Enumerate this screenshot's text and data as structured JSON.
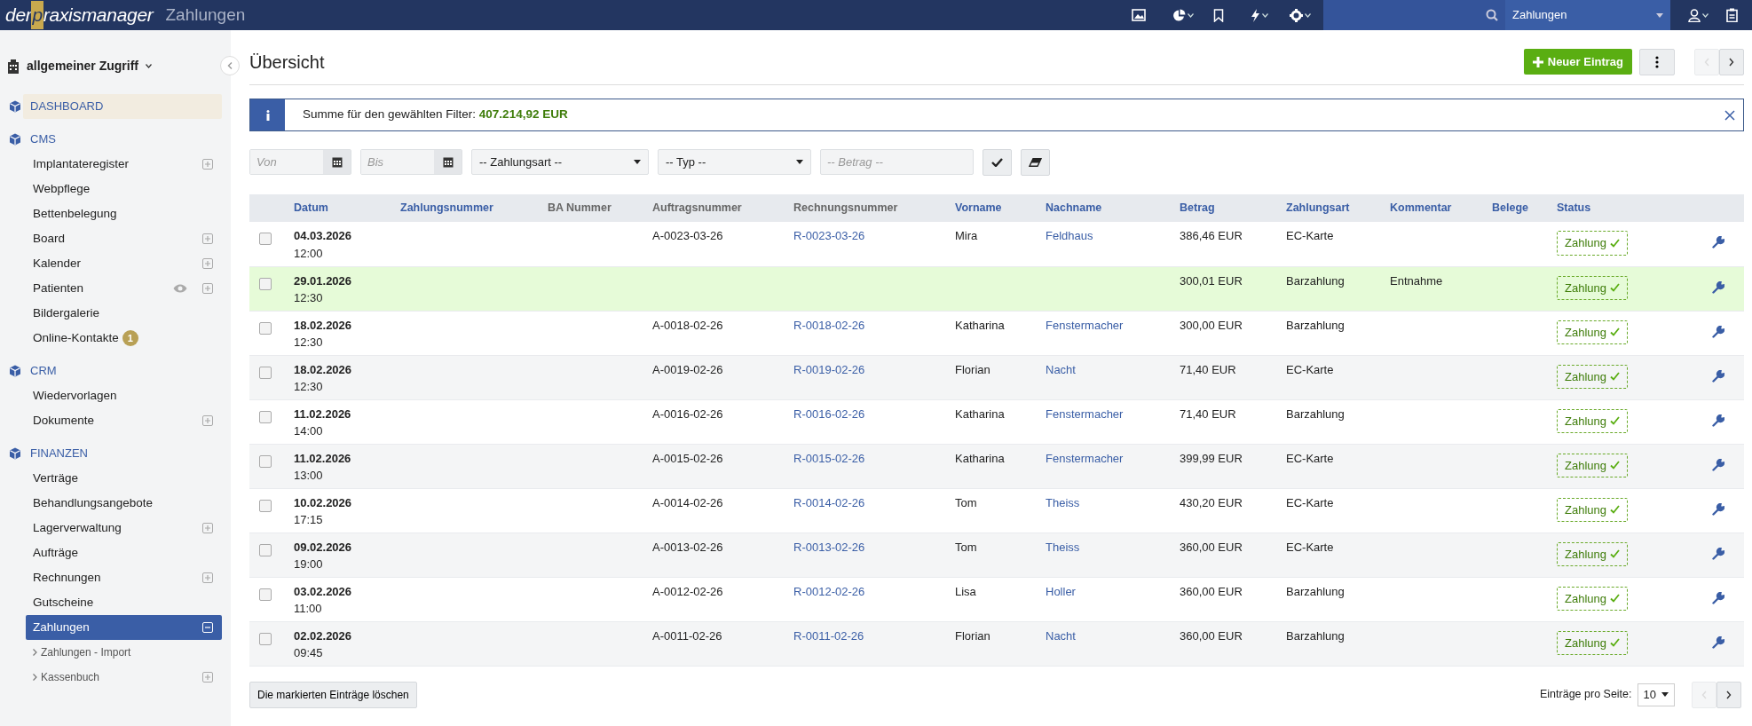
{
  "topbar": {
    "logo": {
      "prefix": "der",
      "highlight": "p",
      "suffix": "raxismanager"
    },
    "title": "Zahlungen",
    "module_select": "Zahlungen"
  },
  "sidebar": {
    "workspace": "allgemeiner Zugriff",
    "sections": [
      {
        "title": "DASHBOARD",
        "selected": true
      },
      {
        "title": "CMS",
        "selected": false,
        "items": [
          {
            "label": "Implantateregister",
            "expanded": false,
            "eye": false,
            "selected": false
          },
          {
            "label": "Webpflege",
            "eye": false,
            "selected": false
          },
          {
            "label": "Bettenbelegung",
            "eye": false,
            "selected": false
          },
          {
            "label": "Board",
            "expanded": false,
            "eye": false,
            "selected": false
          },
          {
            "label": "Kalender",
            "expanded": false,
            "eye": false,
            "selected": false
          },
          {
            "label": "Patienten",
            "expanded": false,
            "eye": true,
            "selected": false
          },
          {
            "label": "Bildergalerie",
            "eye": false,
            "selected": false
          },
          {
            "label": "Online-Kontakte",
            "eye": false,
            "selected": false,
            "badge": "1"
          }
        ]
      },
      {
        "title": "CRM",
        "selected": false,
        "items": [
          {
            "label": "Wiedervorlagen",
            "eye": false,
            "selected": false
          },
          {
            "label": "Dokumente",
            "expanded": false,
            "eye": false,
            "selected": false
          }
        ]
      },
      {
        "title": "FINANZEN",
        "selected": false,
        "items": [
          {
            "label": "Verträge",
            "eye": false,
            "selected": false
          },
          {
            "label": "Behandlungsangebote",
            "eye": false,
            "selected": false
          },
          {
            "label": "Lagerverwaltung",
            "expanded": false,
            "eye": false,
            "selected": false
          },
          {
            "label": "Aufträge",
            "eye": false,
            "selected": false
          },
          {
            "label": "Rechnungen",
            "expanded": false,
            "eye": false,
            "selected": false
          },
          {
            "label": "Gutscheine",
            "eye": false,
            "selected": false
          },
          {
            "label": "Zahlungen",
            "expanded": true,
            "eye": false,
            "selected": true,
            "children": [
              {
                "label": "Zahlungen - Import",
                "eye": false,
                "selected": false
              },
              {
                "label": "Kassenbuch",
                "expanded": false,
                "eye": false,
                "selected": false
              }
            ]
          }
        ]
      }
    ]
  },
  "page": {
    "title": "Übersicht",
    "new_button": "Neuer Eintrag",
    "info": "Summe für den gewählten Filter: **407.214,92 EUR**",
    "filters": {
      "von": {
        "placeholder": "Von"
      },
      "bis": {
        "placeholder": "Bis"
      },
      "zahlungsart": "-- Zahlungsart --",
      "typ": "-- Typ --",
      "betrag": {
        "placeholder": "-- Betrag --"
      }
    },
    "table": {
      "columns": [
        {
          "label": "Datum",
          "sortable": true
        },
        {
          "label": "Zahlungsnummer",
          "sortable": true
        },
        {
          "label": "BA Nummer",
          "sortable": false
        },
        {
          "label": "Auftragsnummer",
          "sortable": false
        },
        {
          "label": "Rechnungsnummer",
          "sortable": false
        },
        {
          "label": "Vorname",
          "sortable": true
        },
        {
          "label": "Nachname",
          "sortable": true
        },
        {
          "label": "Betrag",
          "sortable": true
        },
        {
          "label": "Zahlungsart",
          "sortable": true
        },
        {
          "label": "Kommentar",
          "sortable": true
        },
        {
          "label": "Belege",
          "sortable": true
        },
        {
          "label": "Status",
          "sortable": true
        }
      ],
      "rows": [
        {
          "checked": false,
          "highlighted": false,
          "date": "04.03.2026",
          "time": "12:00",
          "auftragsnummer": "A-0023-03-26",
          "rechnungsnummer": "R-0023-03-26",
          "vorname": "Mira",
          "nachname": "Feldhaus",
          "betrag": "386,46 EUR",
          "zahlungsart": "EC-Karte",
          "status": "Zahlung"
        },
        {
          "checked": false,
          "highlighted": true,
          "date": "29.01.2026",
          "time": "12:30",
          "betrag": "300,01 EUR",
          "zahlungsart": "Barzahlung",
          "kommentar": "Entnahme",
          "status": "Zahlung"
        },
        {
          "checked": false,
          "highlighted": false,
          "date": "18.02.2026",
          "time": "12:30",
          "auftragsnummer": "A-0018-02-26",
          "rechnungsnummer": "R-0018-02-26",
          "vorname": "Katharina",
          "nachname": "Fenstermacher",
          "betrag": "300,00 EUR",
          "zahlungsart": "Barzahlung",
          "status": "Zahlung"
        },
        {
          "checked": false,
          "highlighted": false,
          "date": "18.02.2026",
          "time": "12:30",
          "auftragsnummer": "A-0019-02-26",
          "rechnungsnummer": "R-0019-02-26",
          "vorname": "Florian",
          "nachname": "Nacht",
          "betrag": "71,40 EUR",
          "zahlungsart": "EC-Karte",
          "status": "Zahlung"
        },
        {
          "checked": false,
          "highlighted": false,
          "date": "11.02.2026",
          "time": "14:00",
          "auftragsnummer": "A-0016-02-26",
          "rechnungsnummer": "R-0016-02-26",
          "vorname": "Katharina",
          "nachname": "Fenstermacher",
          "betrag": "71,40 EUR",
          "zahlungsart": "Barzahlung",
          "status": "Zahlung"
        },
        {
          "checked": false,
          "highlighted": false,
          "date": "11.02.2026",
          "time": "13:00",
          "auftragsnummer": "A-0015-02-26",
          "rechnungsnummer": "R-0015-02-26",
          "vorname": "Katharina",
          "nachname": "Fenstermacher",
          "betrag": "399,99 EUR",
          "zahlungsart": "EC-Karte",
          "status": "Zahlung"
        },
        {
          "checked": false,
          "highlighted": false,
          "date": "10.02.2026",
          "time": "17:15",
          "auftragsnummer": "A-0014-02-26",
          "rechnungsnummer": "R-0014-02-26",
          "vorname": "Tom",
          "nachname": "Theiss",
          "betrag": "430,20 EUR",
          "zahlungsart": "EC-Karte",
          "status": "Zahlung"
        },
        {
          "checked": false,
          "highlighted": false,
          "date": "09.02.2026",
          "time": "19:00",
          "auftragsnummer": "A-0013-02-26",
          "rechnungsnummer": "R-0013-02-26",
          "vorname": "Tom",
          "nachname": "Theiss",
          "betrag": "360,00 EUR",
          "zahlungsart": "EC-Karte",
          "status": "Zahlung"
        },
        {
          "checked": false,
          "highlighted": false,
          "date": "03.02.2026",
          "time": "11:00",
          "auftragsnummer": "A-0012-02-26",
          "rechnungsnummer": "R-0012-02-26",
          "vorname": "Lisa",
          "nachname": "Holler",
          "betrag": "360,00 EUR",
          "zahlungsart": "Barzahlung",
          "status": "Zahlung"
        },
        {
          "checked": false,
          "highlighted": false,
          "date": "02.02.2026",
          "time": "09:45",
          "auftragsnummer": "A-0011-02-26",
          "rechnungsnummer": "R-0011-02-26",
          "vorname": "Florian",
          "nachname": "Nacht",
          "betrag": "360,00 EUR",
          "zahlungsart": "Barzahlung",
          "status": "Zahlung"
        }
      ]
    },
    "delete_button": "Die markierten Einträge löschen",
    "per_page_label": "Einträge pro Seite:",
    "per_page": "10"
  }
}
